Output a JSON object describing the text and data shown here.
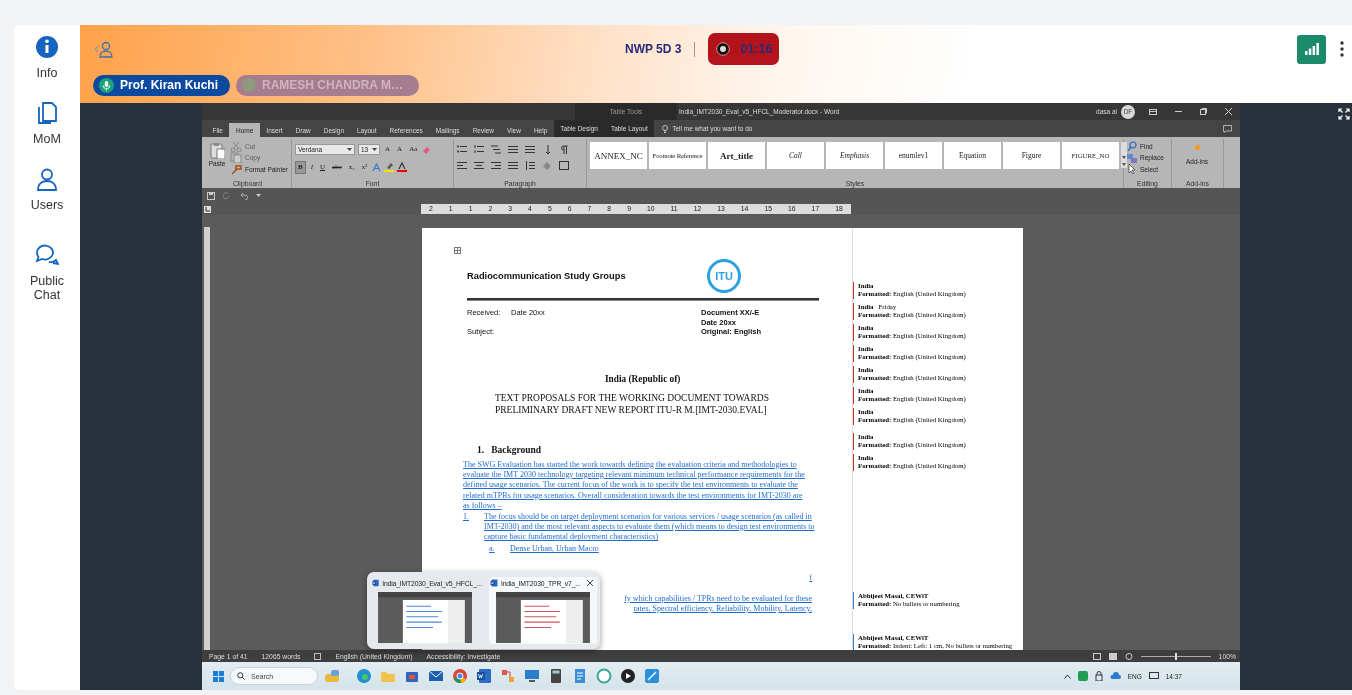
{
  "sidebar": {
    "items": [
      {
        "kind": "info",
        "label": "Info"
      },
      {
        "kind": "minutes",
        "label": "MoM"
      },
      {
        "kind": "users",
        "label": "Users"
      },
      {
        "kind": "chat",
        "label": "Public Chat"
      }
    ]
  },
  "header": {
    "meeting_title": "NWP 5D 3",
    "recording": {
      "on": true,
      "time": "01:16"
    },
    "participants": [
      {
        "name": "Prof. Kiran Kuchi",
        "speaking": true
      },
      {
        "name": "RAMESH CHANDRA M…",
        "speaking": false
      }
    ]
  },
  "shared_screen": {
    "word": {
      "title_bar": {
        "context_label": "Table Tools",
        "document_title": "India_IMT2030_Eval_v5_HFCL_Moderator.docx  -  Word",
        "user_name": "dasa ai",
        "user_initials": "DF"
      },
      "tabs": [
        {
          "label": "File",
          "selected": false,
          "contextual": false
        },
        {
          "label": "Home",
          "selected": true,
          "contextual": false
        },
        {
          "label": "Insert",
          "selected": false,
          "contextual": false
        },
        {
          "label": "Draw",
          "selected": false,
          "contextual": false
        },
        {
          "label": "Design",
          "selected": false,
          "contextual": false
        },
        {
          "label": "Layout",
          "selected": false,
          "contextual": false
        },
        {
          "label": "References",
          "selected": false,
          "contextual": false
        },
        {
          "label": "Mailings",
          "selected": false,
          "contextual": false
        },
        {
          "label": "Review",
          "selected": false,
          "contextual": false
        },
        {
          "label": "View",
          "selected": false,
          "contextual": false
        },
        {
          "label": "Help",
          "selected": false,
          "contextual": false
        },
        {
          "label": "Table Design",
          "selected": false,
          "contextual": true
        },
        {
          "label": "Table Layout",
          "selected": false,
          "contextual": true
        }
      ],
      "tell_me": "Tell me what you want to do",
      "ribbon": {
        "clipboard": {
          "label": "Clipboard",
          "paste": "Paste",
          "items": [
            {
              "label": "Cut",
              "disabled": true
            },
            {
              "label": "Copy",
              "disabled": true
            },
            {
              "label": "Format Painter",
              "disabled": false
            }
          ]
        },
        "font": {
          "label": "Font",
          "font_name": "Verdana",
          "font_size": "13",
          "size_tools": [
            "A",
            "A",
            "Aa"
          ],
          "format_buttons": [
            {
              "label": "B",
              "selected": true
            },
            {
              "label": "I",
              "selected": false
            },
            {
              "label": "U",
              "selected": false
            },
            {
              "label": "abc",
              "selected": false
            },
            {
              "label": "x₂",
              "selected": false
            },
            {
              "label": "x²",
              "selected": false
            }
          ]
        },
        "paragraph": {
          "label": "Paragraph"
        },
        "styles": {
          "label": "Styles",
          "items": [
            "ANNEX_NC",
            "Footnote Reference",
            "Art_title",
            "Call",
            "Emphasis",
            "enumlev1",
            "Equation",
            "Figure",
            "FIGURE_NO"
          ]
        },
        "editing": {
          "label": "Editing",
          "items": [
            "Find",
            "Replace",
            "Select"
          ]
        },
        "addins": {
          "label": "Add-ins",
          "button": "Add-ins"
        }
      },
      "ruler": [
        "2",
        "1",
        "1",
        "2",
        "3",
        "4",
        "5",
        "6",
        "7",
        "8",
        "9",
        "10",
        "11",
        "12",
        "13",
        "14",
        "15",
        "16",
        "17",
        "18"
      ],
      "document": {
        "group_title": "Radiocommunication Study Groups",
        "logo_text": "ITU",
        "received_label": "Received:",
        "received_value": "Date 20xx",
        "subject_label": "Subject:",
        "doc_info": [
          "Document XX/-E",
          "Date 20xx",
          "Original: English"
        ],
        "source": "India (Republic of)",
        "title": "TEXT PROPOSALS FOR THE WORKING DOCUMENT TOWARDS PRELIMINARY DRAFT NEW REPORT ITU-R M.[IMT-2030.EVAL]",
        "heading_number": "1.",
        "heading": "Background",
        "paragraph": "The SWG Evaluation has started the work towards defining the evaluation criteria and methodologies to evaluate the IMT 2030 technology targeting relevant minimum technical performance requirements for the defined usage scenarios. The current focus of the work is to specify the test environments to evaluate the related mTPRs for usage scenarios. Overall consideration towards the test environments for IMT-2030 are as follows –",
        "list_items": [
          {
            "marker": "1.",
            "text": "The focus should be on target deployment scenarios for various services / usage scenarios (as called in IMT-2030) and the most relevant aspects to evaluate them (which means to design test environments to capture basic fundamental deployment characteristics)"
          },
          {
            "marker": "a.",
            "text": "Dense Urban, Urban Macro"
          }
        ],
        "partial_lines": [
          "f",
          "fy which capabilities / TPRs need to be evaluated for these",
          "rates, Spectral efficiency, Reliability, Mobility, Latency,"
        ]
      },
      "comments": [
        {
          "author": "India",
          "detail": "**Formatted:** English (United Kingdom)",
          "color": "#c9302c"
        },
        {
          "author": "India",
          "time": "Friday",
          "detail": "**Formatted:** English (United Kingdom)",
          "color": "#c9302c"
        },
        {
          "author": "India",
          "detail": "**Formatted:** English (United Kingdom)",
          "color": "#c9302c"
        },
        {
          "author": "India",
          "detail": "**Formatted:** English (United Kingdom)",
          "color": "#c9302c"
        },
        {
          "author": "India",
          "detail": "**Formatted:** English (United Kingdom)",
          "color": "#c9302c"
        },
        {
          "author": "India",
          "detail": "**Formatted:** English (United Kingdom)",
          "color": "#c9302c"
        },
        {
          "author": "India",
          "detail": "**Formatted:** English (United Kingdom)",
          "color": "#c9302c"
        },
        {
          "author": "India",
          "detail": "**Formatted:** English (United Kingdom)",
          "color": "#c9302c"
        },
        {
          "author": "India",
          "detail": "**Formatted:** English (United Kingdom)",
          "color": "#c9302c"
        },
        {
          "author": "Abhijeet Masal, CEWiT",
          "detail": "**Formatted:**  No bullets or numbering",
          "color": "#2f7fd0"
        },
        {
          "author": "Abhijeet Masal, CEWiT",
          "detail": "**Formatted:** Indent: Left:  1 cm,  No bullets or numbering",
          "color": "#2f7fd0"
        }
      ],
      "status_bar": {
        "items": [
          "Page 1 of 41",
          "12065 words",
          "English (United Kingdom)",
          "Accessibility: Investigate"
        ],
        "zoom_slider": {
          "level": 0.5
        },
        "zoom": "100%"
      }
    },
    "switcher": {
      "windows": [
        {
          "title": "India_IMT2030_Eval_v5_HFCL_...",
          "hovered": false
        },
        {
          "title": "India_IMT2030_TPR_v7_...",
          "hovered": true
        }
      ]
    },
    "taskbar": {
      "search_placeholder": "Search",
      "language": "ENG",
      "time": "14:37"
    }
  }
}
